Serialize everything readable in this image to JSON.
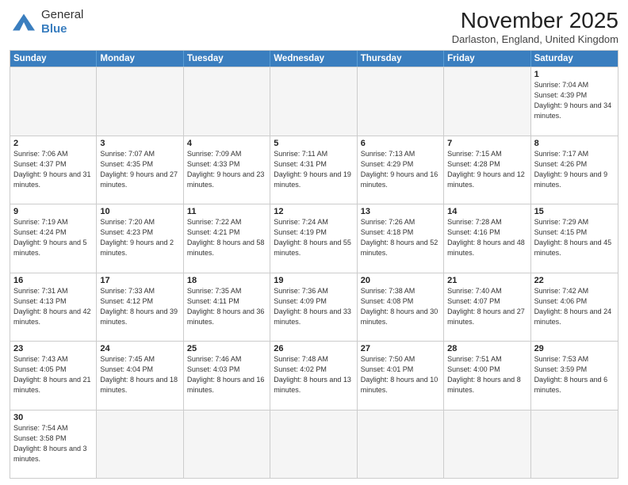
{
  "logo": {
    "line1": "General",
    "line2": "Blue"
  },
  "title": "November 2025",
  "location": "Darlaston, England, United Kingdom",
  "days_of_week": [
    "Sunday",
    "Monday",
    "Tuesday",
    "Wednesday",
    "Thursday",
    "Friday",
    "Saturday"
  ],
  "weeks": [
    [
      {
        "day": "",
        "info": "",
        "empty": true
      },
      {
        "day": "",
        "info": "",
        "empty": true
      },
      {
        "day": "",
        "info": "",
        "empty": true
      },
      {
        "day": "",
        "info": "",
        "empty": true
      },
      {
        "day": "",
        "info": "",
        "empty": true
      },
      {
        "day": "",
        "info": "",
        "empty": true
      },
      {
        "day": "1",
        "info": "Sunrise: 7:04 AM\nSunset: 4:39 PM\nDaylight: 9 hours\nand 34 minutes."
      }
    ],
    [
      {
        "day": "2",
        "info": "Sunrise: 7:06 AM\nSunset: 4:37 PM\nDaylight: 9 hours\nand 31 minutes."
      },
      {
        "day": "3",
        "info": "Sunrise: 7:07 AM\nSunset: 4:35 PM\nDaylight: 9 hours\nand 27 minutes."
      },
      {
        "day": "4",
        "info": "Sunrise: 7:09 AM\nSunset: 4:33 PM\nDaylight: 9 hours\nand 23 minutes."
      },
      {
        "day": "5",
        "info": "Sunrise: 7:11 AM\nSunset: 4:31 PM\nDaylight: 9 hours\nand 19 minutes."
      },
      {
        "day": "6",
        "info": "Sunrise: 7:13 AM\nSunset: 4:29 PM\nDaylight: 9 hours\nand 16 minutes."
      },
      {
        "day": "7",
        "info": "Sunrise: 7:15 AM\nSunset: 4:28 PM\nDaylight: 9 hours\nand 12 minutes."
      },
      {
        "day": "8",
        "info": "Sunrise: 7:17 AM\nSunset: 4:26 PM\nDaylight: 9 hours\nand 9 minutes."
      }
    ],
    [
      {
        "day": "9",
        "info": "Sunrise: 7:19 AM\nSunset: 4:24 PM\nDaylight: 9 hours\nand 5 minutes."
      },
      {
        "day": "10",
        "info": "Sunrise: 7:20 AM\nSunset: 4:23 PM\nDaylight: 9 hours\nand 2 minutes."
      },
      {
        "day": "11",
        "info": "Sunrise: 7:22 AM\nSunset: 4:21 PM\nDaylight: 8 hours\nand 58 minutes."
      },
      {
        "day": "12",
        "info": "Sunrise: 7:24 AM\nSunset: 4:19 PM\nDaylight: 8 hours\nand 55 minutes."
      },
      {
        "day": "13",
        "info": "Sunrise: 7:26 AM\nSunset: 4:18 PM\nDaylight: 8 hours\nand 52 minutes."
      },
      {
        "day": "14",
        "info": "Sunrise: 7:28 AM\nSunset: 4:16 PM\nDaylight: 8 hours\nand 48 minutes."
      },
      {
        "day": "15",
        "info": "Sunrise: 7:29 AM\nSunset: 4:15 PM\nDaylight: 8 hours\nand 45 minutes."
      }
    ],
    [
      {
        "day": "16",
        "info": "Sunrise: 7:31 AM\nSunset: 4:13 PM\nDaylight: 8 hours\nand 42 minutes."
      },
      {
        "day": "17",
        "info": "Sunrise: 7:33 AM\nSunset: 4:12 PM\nDaylight: 8 hours\nand 39 minutes."
      },
      {
        "day": "18",
        "info": "Sunrise: 7:35 AM\nSunset: 4:11 PM\nDaylight: 8 hours\nand 36 minutes."
      },
      {
        "day": "19",
        "info": "Sunrise: 7:36 AM\nSunset: 4:09 PM\nDaylight: 8 hours\nand 33 minutes."
      },
      {
        "day": "20",
        "info": "Sunrise: 7:38 AM\nSunset: 4:08 PM\nDaylight: 8 hours\nand 30 minutes."
      },
      {
        "day": "21",
        "info": "Sunrise: 7:40 AM\nSunset: 4:07 PM\nDaylight: 8 hours\nand 27 minutes."
      },
      {
        "day": "22",
        "info": "Sunrise: 7:42 AM\nSunset: 4:06 PM\nDaylight: 8 hours\nand 24 minutes."
      }
    ],
    [
      {
        "day": "23",
        "info": "Sunrise: 7:43 AM\nSunset: 4:05 PM\nDaylight: 8 hours\nand 21 minutes."
      },
      {
        "day": "24",
        "info": "Sunrise: 7:45 AM\nSunset: 4:04 PM\nDaylight: 8 hours\nand 18 minutes."
      },
      {
        "day": "25",
        "info": "Sunrise: 7:46 AM\nSunset: 4:03 PM\nDaylight: 8 hours\nand 16 minutes."
      },
      {
        "day": "26",
        "info": "Sunrise: 7:48 AM\nSunset: 4:02 PM\nDaylight: 8 hours\nand 13 minutes."
      },
      {
        "day": "27",
        "info": "Sunrise: 7:50 AM\nSunset: 4:01 PM\nDaylight: 8 hours\nand 10 minutes."
      },
      {
        "day": "28",
        "info": "Sunrise: 7:51 AM\nSunset: 4:00 PM\nDaylight: 8 hours\nand 8 minutes."
      },
      {
        "day": "29",
        "info": "Sunrise: 7:53 AM\nSunset: 3:59 PM\nDaylight: 8 hours\nand 6 minutes."
      }
    ],
    [
      {
        "day": "30",
        "info": "Sunrise: 7:54 AM\nSunset: 3:58 PM\nDaylight: 8 hours\nand 3 minutes."
      },
      {
        "day": "",
        "info": "",
        "empty": true
      },
      {
        "day": "",
        "info": "",
        "empty": true
      },
      {
        "day": "",
        "info": "",
        "empty": true
      },
      {
        "day": "",
        "info": "",
        "empty": true
      },
      {
        "day": "",
        "info": "",
        "empty": true
      },
      {
        "day": "",
        "info": "",
        "empty": true
      }
    ]
  ]
}
